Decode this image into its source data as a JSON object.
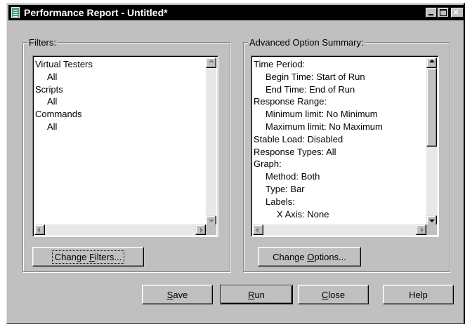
{
  "window": {
    "title": "Performance Report - Untitled*",
    "controls": {
      "minimize": "minimize",
      "maximize": "maximize",
      "close": "×"
    }
  },
  "filters": {
    "label": "Filters:",
    "items": [
      {
        "text": "Virtual Testers",
        "level": 0
      },
      {
        "text": "All",
        "level": 1
      },
      {
        "text": "Scripts",
        "level": 0
      },
      {
        "text": "All",
        "level": 1
      },
      {
        "text": "Commands",
        "level": 0
      },
      {
        "text": "All",
        "level": 1
      }
    ],
    "button": {
      "pre": "Change ",
      "mn": "F",
      "post": "ilters..."
    }
  },
  "summary": {
    "label": "Advanced Option Summary:",
    "items": [
      {
        "text": "Time Period:",
        "level": 0
      },
      {
        "text": "Begin Time: Start of Run",
        "level": 1
      },
      {
        "text": "End Time: End of Run",
        "level": 1
      },
      {
        "text": "Response Range:",
        "level": 0
      },
      {
        "text": "Minimum limit: No Minimum",
        "level": 1
      },
      {
        "text": "Maximum limit: No Maximum",
        "level": 1
      },
      {
        "text": "Stable Load: Disabled",
        "level": 0
      },
      {
        "text": "Response Types: All",
        "level": 0
      },
      {
        "text": "Graph:",
        "level": 0
      },
      {
        "text": "Method: Both",
        "level": 1
      },
      {
        "text": "Type: Bar",
        "level": 1
      },
      {
        "text": "Labels:",
        "level": 1
      },
      {
        "text": "X Axis: None",
        "level": 2
      }
    ],
    "button": {
      "pre": "Change ",
      "mn": "O",
      "post": "ptions..."
    }
  },
  "footer": {
    "save": {
      "pre": "",
      "mn": "S",
      "post": "ave"
    },
    "run": {
      "pre": "",
      "mn": "R",
      "post": "un"
    },
    "close": {
      "pre": "",
      "mn": "C",
      "post": "lose"
    },
    "help": {
      "pre": "",
      "mn": "",
      "post": "Help"
    }
  }
}
